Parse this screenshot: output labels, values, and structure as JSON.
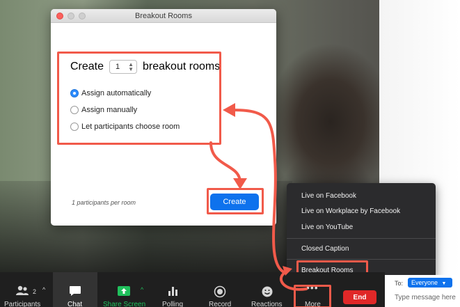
{
  "dialog": {
    "title": "Breakout Rooms",
    "create_prefix": "Create",
    "room_count": "1",
    "create_suffix": "breakout rooms",
    "options": [
      {
        "label": "Assign automatically",
        "selected": true
      },
      {
        "label": "Assign manually",
        "selected": false
      },
      {
        "label": "Let participants choose room",
        "selected": false
      }
    ],
    "per_room_text": "1 participants per room",
    "create_button": "Create"
  },
  "more_menu": {
    "items": [
      "Live on Facebook",
      "Live on Workplace by Facebook",
      "Live on YouTube",
      "Closed Caption",
      "Breakout Rooms"
    ]
  },
  "toolbar": {
    "participants_label": "Participants",
    "participants_count": "2",
    "chat_label": "Chat",
    "share_label": "Share Screen",
    "polling_label": "Polling",
    "record_label": "Record",
    "reactions_label": "Reactions",
    "more_label": "More",
    "end_label": "End"
  },
  "chat": {
    "to_label": "To:",
    "recipient": "Everyone",
    "message_placeholder": "Type message here"
  },
  "colors": {
    "accent_blue": "#0e72ed",
    "highlight_red": "#f15a4a",
    "end_red": "#e02828",
    "share_green": "#20c05c"
  }
}
